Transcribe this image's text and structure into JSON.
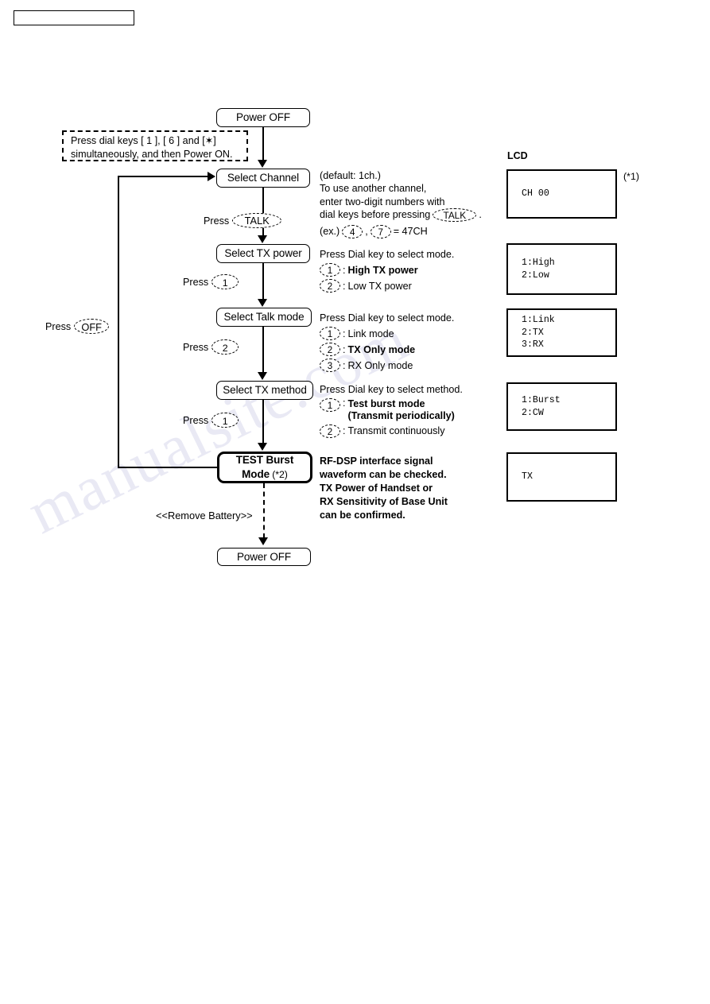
{
  "header": {
    "box_label": ""
  },
  "flow": {
    "power_off_top": "Power OFF",
    "select_channel": "Select Channel",
    "select_tx_power": "Select TX power",
    "select_talk_mode": "Select Talk mode",
    "select_tx_method": "Select TX method",
    "test_burst_mode_line1": "TEST Burst",
    "test_burst_mode_line2": "Mode",
    "test_burst_mode_note": "(*2)",
    "power_off_bottom": "Power OFF",
    "remove_battery": "<<Remove Battery>>"
  },
  "note_box": {
    "line1": "Press dial keys [ 1 ], [ 6 ] and [✶]",
    "line2": "simultaneously, and then Power ON."
  },
  "presses": {
    "press_label": "Press",
    "talk_key": "TALK",
    "one_key": "1",
    "two_key": "2",
    "one_key_b": "1",
    "off_key": "OFF"
  },
  "descriptions": {
    "channel": {
      "line1": "(default: 1ch.)",
      "line2": "To use another channel,",
      "line3": "enter two-digit numbers with",
      "line4_pre": "dial keys before pressing",
      "line4_key": "TALK",
      "line4_post": ".",
      "ex_pre": "(ex.)",
      "ex_key1": "4",
      "ex_sep": ",",
      "ex_key2": "7",
      "ex_post": "= 47CH"
    },
    "tx_power": {
      "heading": "Press Dial key to select mode.",
      "options": [
        {
          "key": "1",
          "sep": ":",
          "label": "High TX power",
          "bold": true
        },
        {
          "key": "2",
          "sep": ":",
          "label": "Low TX power",
          "bold": false
        }
      ]
    },
    "talk_mode": {
      "heading": "Press Dial key to select mode.",
      "options": [
        {
          "key": "1",
          "sep": ":",
          "label": "Link mode",
          "bold": false
        },
        {
          "key": "2",
          "sep": ":",
          "label": "TX Only mode",
          "bold": true
        },
        {
          "key": "3",
          "sep": ":",
          "label": "RX Only mode",
          "bold": false
        }
      ]
    },
    "tx_method": {
      "heading": "Press Dial key to select method.",
      "options": [
        {
          "key": "1",
          "sep": ":",
          "label": "Test burst mode",
          "label2": "(Transmit periodically)",
          "bold": true
        },
        {
          "key": "2",
          "sep": ":",
          "label": "Transmit continuously",
          "bold": false
        }
      ]
    },
    "burst_info": "RF-DSP interface signal\nwaveform can be checked.\nTX Power of Handset or\nRX Sensitivity of Base Unit\ncan be confirmed."
  },
  "lcd": {
    "title": "LCD",
    "note": "(*1)",
    "panels": [
      {
        "name": "channel-display",
        "text": "CH 00"
      },
      {
        "name": "tx-power-display",
        "text": "1:High\n2:Low"
      },
      {
        "name": "talk-mode-display",
        "text": "1:Link\n2:TX\n3:RX"
      },
      {
        "name": "tx-method-display",
        "text": "1:Burst\n2:CW"
      },
      {
        "name": "transmit-display",
        "text": "TX"
      }
    ]
  },
  "watermark": {
    "text": "manualsite.com"
  }
}
